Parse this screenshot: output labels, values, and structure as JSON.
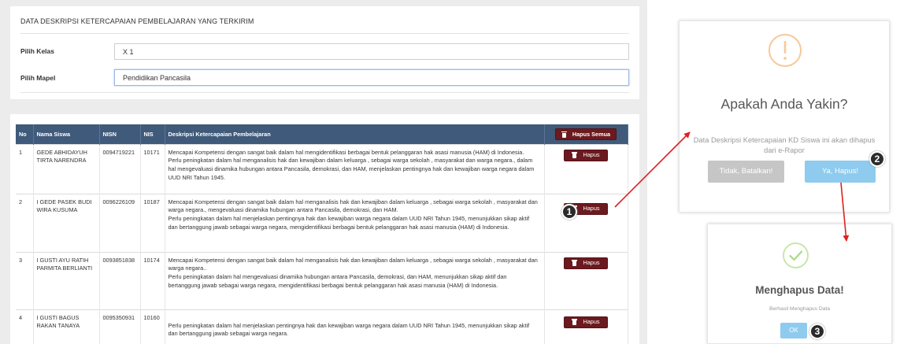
{
  "filter": {
    "title": "DATA DESKRIPSI KETERCAPAIAN PEMBELAJARAN YANG TERKIRIM",
    "kelas_label": "Pilih Kelas",
    "kelas_value": "X 1",
    "mapel_label": "Pilih Mapel",
    "mapel_value": "Pendidikan Pancasila"
  },
  "table": {
    "headers": [
      "No",
      "Nama Siswa",
      "NISN",
      "NIS",
      "Deskripsi Ketercapaian Pembelajaran"
    ],
    "hapus_semua_label": "Hapus Semua",
    "hapus_label": "Hapus",
    "rows": [
      {
        "no": "1",
        "nama": "GEDE ABHIDAYUH TIRTA NARENDRA",
        "nisn": "0094719221",
        "nis": "10171",
        "desc": [
          "Mencapai Kompetensi dengan sangat baik dalam hal mengidentifikasi berbagai bentuk pelanggaran hak asasi manusia (HAM) di Indonesia.",
          "Perlu peningkatan dalam hal menganalisis hak dan kewajiban dalam keluarga , sebagai warga sekolah , masyarakat dan warga negara., dalam hal mengevaluasi dinamika hubungan antara Pancasila, demokrasi, dan HAM, menjelaskan pentingnya hak dan kewajiban warga negara dalam UUD NRI Tahun 1945."
        ]
      },
      {
        "no": "2",
        "nama": "I GEDE PASEK BUDI WIRA KUSUMA",
        "nisn": "0096226109",
        "nis": "10187",
        "desc": [
          "Mencapai Kompetensi dengan sangat baik dalam hal menganalisis hak dan kewajiban dalam keluarga , sebagai warga sekolah , masyarakat dan warga negara., mengevaluasi dinamika hubungan antara Pancasila, demokrasi, dan HAM.",
          "Perlu peningkatan dalam hal menjelaskan pentingnya hak dan kewajiban warga negara dalam UUD NRI Tahun 1945, menunjukkan sikap aktif dan bertanggung jawab sebagai warga negara, mengidentifikasi berbagai bentuk pelanggaran hak asasi manusia (HAM) di Indonesia."
        ]
      },
      {
        "no": "3",
        "nama": "I GUSTI AYU RATIH PARMITA BERLIANTI",
        "nisn": "0093851838",
        "nis": "10174",
        "desc": [
          "Mencapai Kompetensi dengan sangat baik dalam hal menganalisis hak dan kewajiban dalam keluarga , sebagai warga sekolah , masyarakat dan warga negara..",
          "Perlu peningkatan dalam hal mengevaluasi dinamika hubungan antara Pancasila, demokrasi, dan HAM, menunjukkan sikap aktif dan bertanggung jawab sebagai warga negara, mengidentifikasi berbagai bentuk pelanggaran hak asasi manusia (HAM) di Indonesia."
        ]
      },
      {
        "no": "4",
        "nama": "I GUSTI BAGUS RAKAN TANAYA",
        "nisn": "0095350931",
        "nis": "10160",
        "desc": [
          "",
          "Perlu peningkatan dalam hal menjelaskan pentingnya hak dan kewajiban warga negara dalam UUD NRI Tahun 1945, menunjukkan sikap aktif dan bertanggung jawab sebagai warga negara."
        ]
      }
    ]
  },
  "confirm_dialog": {
    "title": "Apakah Anda Yakin?",
    "message": "Data Deskripsi Ketercapaian KD Siswa ini akan dihapus dari e-Rapor",
    "cancel_label": "Tidak, Batalkan!",
    "confirm_label": "Ya, Hapus!"
  },
  "success_dialog": {
    "title": "Menghapus Data!",
    "message": "Berhasil Menghapus Data",
    "ok_label": "OK"
  },
  "steps": [
    "1",
    "2",
    "3"
  ],
  "colors": {
    "table_header": "#3f5a7a",
    "delete_button": "#6b1a1f",
    "primary_button": "#8ecbee",
    "cancel_button": "#c6c6c6",
    "warning_icon": "#f8c89b",
    "success_icon": "#a5dc86",
    "arrow": "#e02020"
  },
  "icons": {
    "delete": "trash-icon",
    "warning": "exclamation-icon",
    "success": "checkmark-icon"
  }
}
